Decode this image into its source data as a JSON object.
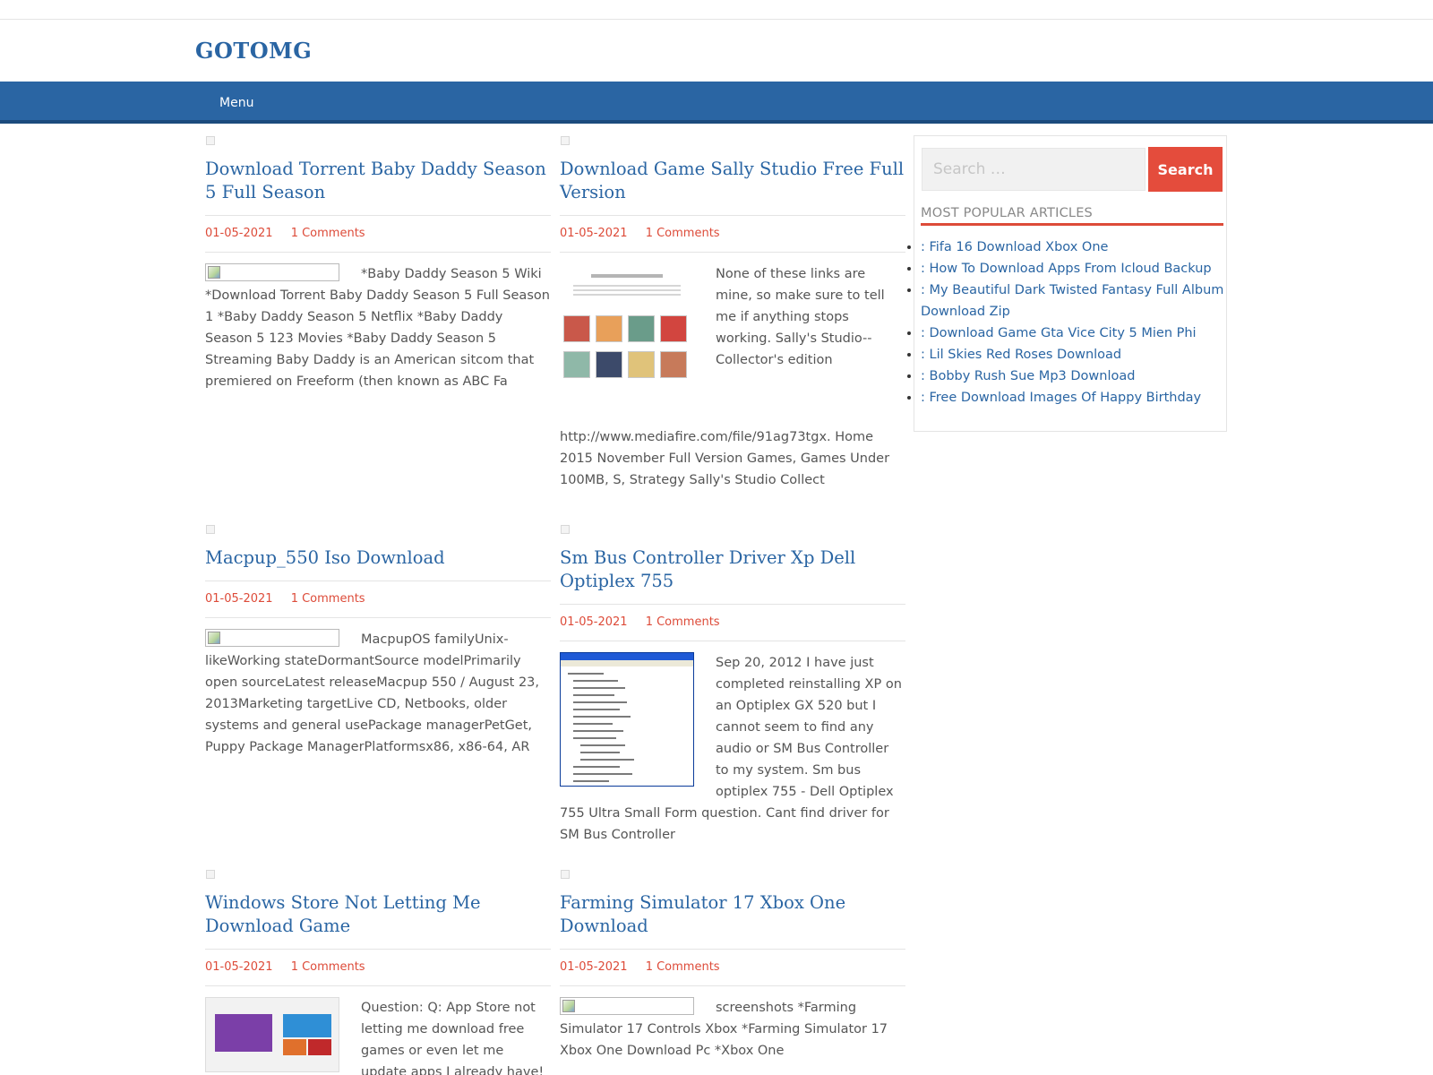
{
  "site": {
    "title": "GOTOMG"
  },
  "nav": {
    "menu_label": "Menu"
  },
  "posts": [
    {
      "title": "Download Torrent Baby Daddy Season 5 Full Season",
      "date": "01-05-2021",
      "comments": "1 Comments",
      "excerpt": "*Baby Daddy Season 5 Wiki *Download Torrent Baby Daddy Season 5 Full Season 1 *Baby Daddy Season 5 Netflix *Baby Daddy Season 5 123 Movies *Baby Daddy Season 5 Streaming Baby Daddy is an American sitcom that premiered on Freeform (then known as ABC Fa",
      "image": "broken-image"
    },
    {
      "title": "Download Game Sally Studio Free Full Version",
      "date": "01-05-2021",
      "comments": "1 Comments",
      "excerpt": "None of these links are mine, so make sure to tell me if anything stops working. Sally's Studio-- Collector's edition http://www.mediafire.com/file/91ag73tgx. Home 2015 November Full Version Games, Games Under 100MB, S, Strategy Sally's Studio Collect",
      "image": "quilt-pattern-image",
      "image_title": "Sally Bernett Signature Collection"
    },
    {
      "title": "Macpup_550 Iso Download",
      "date": "01-05-2021",
      "comments": "1 Comments",
      "excerpt": "MacpupOS familyUnix-likeWorking stateDormantSource modelPrimarily open sourceLatest releaseMacpup 550 / August 23, 2013Marketing targetLive CD, Netbooks, older systems and general usePackage managerPetGet, Puppy Package ManagerPlatformsx86, x86-64, AR",
      "image": "broken-image"
    },
    {
      "title": "Sm Bus Controller Driver Xp Dell Optiplex 755",
      "date": "01-05-2021",
      "comments": "1 Comments",
      "excerpt": "Sep 20, 2012  I have just completed reinstalling XP on an Optiplex GX 520 but I cannot seem to find any audio or SM Bus Controller to my system. Sm bus optiplex 755 - Dell Optiplex 755 Ultra Small Form question. Cant find driver for SM Bus Controller",
      "image": "device-manager-screenshot"
    },
    {
      "title": "Windows Store Not Letting Me Download Game",
      "date": "01-05-2021",
      "comments": "1 Comments",
      "excerpt": "Question: Q: App Store not letting me download free games or even let me update apps I already have! Ok, so I",
      "image": "windows-store-screenshot"
    },
    {
      "title": "Farming Simulator 17 Xbox One Download",
      "date": "01-05-2021",
      "comments": "1 Comments",
      "excerpt": "screenshots *Farming Simulator 17 Controls Xbox *Farming Simulator 17 Xbox One Download Pc *Xbox One",
      "image": "broken-image"
    }
  ],
  "sidebar": {
    "search_placeholder": "Search …",
    "search_button": "Search",
    "popular_title": "MOST POPULAR ARTICLES",
    "popular": [
      ": Fifa 16 Download Xbox One",
      ": How To Download Apps From Icloud Backup",
      ": My Beautiful Dark Twisted Fantasy Full Album Download Zip",
      ": Download Game Gta Vice City 5 Mien Phi",
      ": Lil Skies Red Roses Download",
      ": Bobby Rush Sue Mp3 Download",
      ": Free Download Images Of Happy Birthday"
    ]
  },
  "colors": {
    "brand_blue": "#2a65a3",
    "accent_red": "#dd4b39",
    "search_button": "#e44c3c"
  }
}
